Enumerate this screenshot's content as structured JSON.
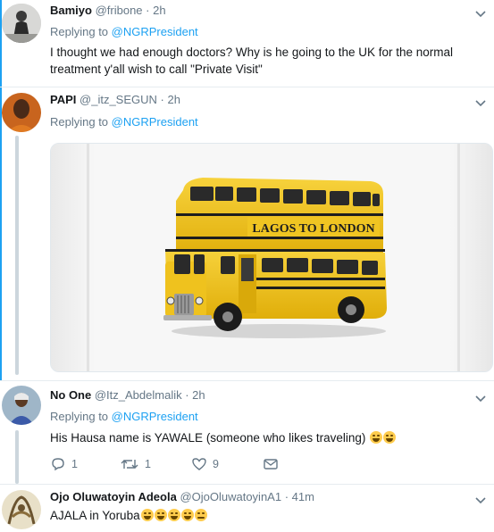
{
  "tweets": [
    {
      "name": "Bamiyo",
      "handle": "@fribone",
      "time": "· 2h",
      "replying_prefix": "Replying to ",
      "replying_to": "@NGRPresident",
      "text_line1": "I thought we had enough doctors? Why is he going to the UK for the normal",
      "text_line2": "treatment y'all wish to call \"Private Visit\""
    },
    {
      "name": "PAPI",
      "handle": "@_itz_SEGUN",
      "time": "· 2h",
      "replying_prefix": "Replying to ",
      "replying_to": "@NGRPresident",
      "media_text": "LAGOS TO LONDON"
    },
    {
      "name": "No One",
      "handle": "@Itz_Abdelmalik",
      "time": "· 2h",
      "replying_prefix": "Replying to ",
      "replying_to": "@NGRPresident",
      "text": "His Hausa name is YAWALE (someone who likes traveling)",
      "reply_count": "1",
      "retweet_count": "1",
      "like_count": "9"
    },
    {
      "name": "Ojo Oluwatoyin Adeola",
      "handle": "@OjoOluwatoyinA1",
      "time": "· 41m",
      "text": "AJALA in Yoruba"
    }
  ],
  "colors": {
    "link": "#1da1f2",
    "secondary_text": "#657786",
    "thread_line": "#ccd6dd",
    "bus_yellow": "#f2c418"
  },
  "icons": [
    "chevron-down-icon",
    "reply-icon",
    "retweet-icon",
    "like-icon",
    "message-icon",
    "tears-of-joy-emoji",
    "flushed-emoji"
  ]
}
